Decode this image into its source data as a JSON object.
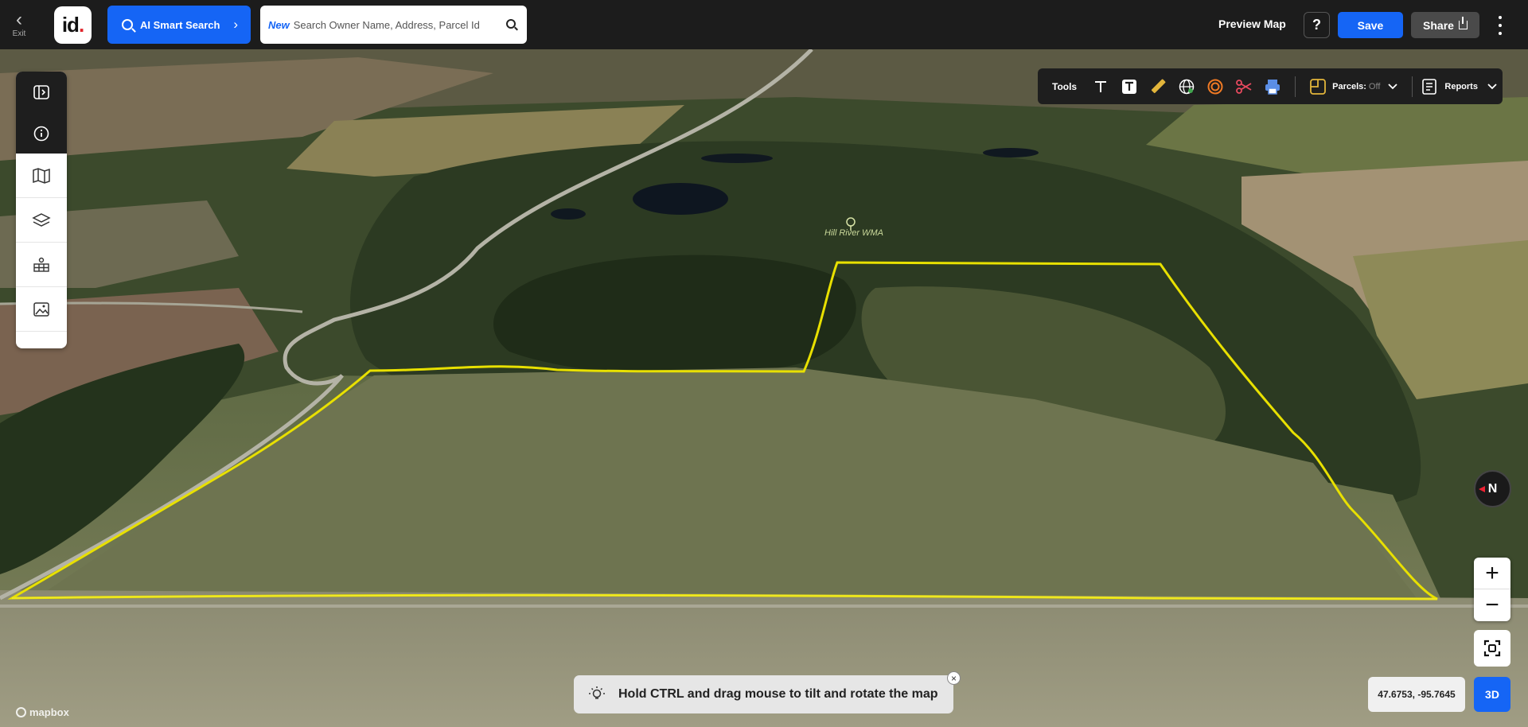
{
  "topbar": {
    "exit_label": "Exit",
    "logo_text": "id",
    "ai_search_label": "AI Smart Search",
    "search_badge": "New",
    "search_placeholder": "Search Owner Name, Address, Parcel Id",
    "preview_label": "Preview Map",
    "help_label": "?",
    "save_label": "Save",
    "share_label": "Share"
  },
  "tools": {
    "label": "Tools",
    "parcels_label": "Parcels:",
    "parcels_state": "Off",
    "reports_label": "Reports"
  },
  "map": {
    "place_label": "Hill River WMA",
    "hint_text": "Hold CTRL and drag mouse to tilt and rotate the map",
    "coordinates": "47.6753, -95.7645",
    "view_mode": "3D",
    "compass_label": "N",
    "attribution": "mapbox",
    "boundary_color": "#e8e000"
  }
}
